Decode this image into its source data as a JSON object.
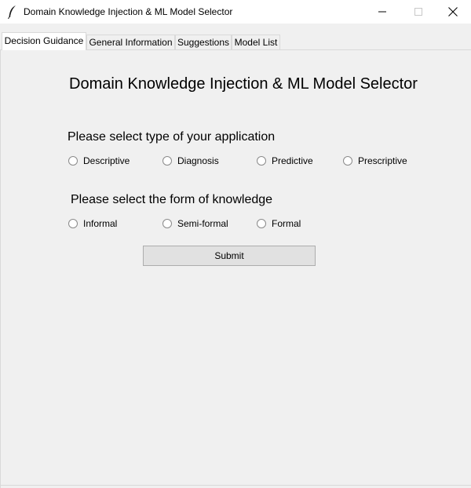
{
  "window": {
    "title": "Domain Knowledge Injection & ML Model Selector"
  },
  "tabs": [
    {
      "label": "Decision Guidance",
      "active": true
    },
    {
      "label": "General Information",
      "active": false
    },
    {
      "label": "Suggestions",
      "active": false
    },
    {
      "label": "Model List",
      "active": false
    }
  ],
  "main": {
    "heading": "Domain Knowledge Injection & ML Model Selector",
    "application_question": "Please select type of your application",
    "application_options": [
      "Descriptive",
      "Diagnosis",
      "Predictive",
      "Prescriptive"
    ],
    "knowledge_question": "Please select the form of knowledge",
    "knowledge_options": [
      "Informal",
      "Semi-formal",
      "Formal"
    ],
    "submit_label": "Submit"
  }
}
